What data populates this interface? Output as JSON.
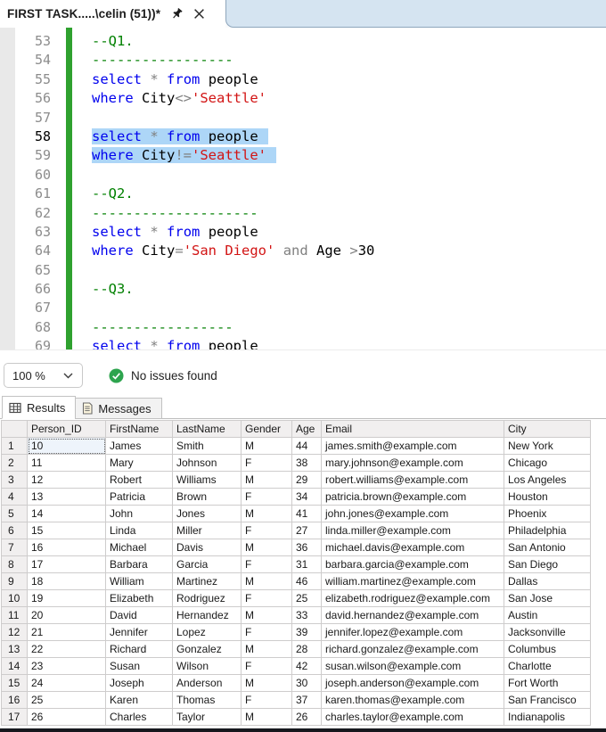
{
  "tab": {
    "title": "FIRST TASK.....\\celin (51))*"
  },
  "colors": {
    "keyword": "#0000ee",
    "operator": "#808080",
    "string": "#d21414",
    "comment": "#008000",
    "selection": "#add6f7",
    "change_bar": "#2fa12f",
    "status_check": "#2da44e",
    "tab_well_fill": "#d5e4f1"
  },
  "editor": {
    "lines": [
      {
        "no": "53",
        "tokens": [
          {
            "c": "c",
            "t": "--Q1."
          }
        ]
      },
      {
        "no": "54",
        "tokens": [
          {
            "c": "c",
            "t": "-----------------"
          }
        ]
      },
      {
        "no": "55",
        "tokens": [
          {
            "c": "k",
            "t": "select"
          },
          {
            "c": "p",
            "t": " "
          },
          {
            "c": "o",
            "t": "*"
          },
          {
            "c": "p",
            "t": " "
          },
          {
            "c": "k",
            "t": "from"
          },
          {
            "c": "p",
            "t": " people"
          }
        ]
      },
      {
        "no": "56",
        "tokens": [
          {
            "c": "k",
            "t": "where"
          },
          {
            "c": "p",
            "t": " City"
          },
          {
            "c": "o",
            "t": "<>"
          },
          {
            "c": "s",
            "t": "'Seattle'"
          }
        ]
      },
      {
        "no": "57",
        "tokens": []
      },
      {
        "no": "58",
        "sel": true,
        "cur": true,
        "tokens": [
          {
            "c": "k",
            "t": "select"
          },
          {
            "c": "p",
            "t": " "
          },
          {
            "c": "o",
            "t": "*"
          },
          {
            "c": "p",
            "t": " "
          },
          {
            "c": "k",
            "t": "from"
          },
          {
            "c": "p",
            "t": " people"
          }
        ]
      },
      {
        "no": "59",
        "sel": true,
        "tokens": [
          {
            "c": "k",
            "t": "where"
          },
          {
            "c": "p",
            "t": " City"
          },
          {
            "c": "o",
            "t": "!="
          },
          {
            "c": "s",
            "t": "'Seattle'"
          }
        ]
      },
      {
        "no": "60",
        "tokens": []
      },
      {
        "no": "61",
        "tokens": [
          {
            "c": "c",
            "t": "--Q2."
          }
        ]
      },
      {
        "no": "62",
        "tokens": [
          {
            "c": "c",
            "t": "--------------------"
          }
        ]
      },
      {
        "no": "63",
        "tokens": [
          {
            "c": "k",
            "t": "select"
          },
          {
            "c": "p",
            "t": " "
          },
          {
            "c": "o",
            "t": "*"
          },
          {
            "c": "p",
            "t": " "
          },
          {
            "c": "k",
            "t": "from"
          },
          {
            "c": "p",
            "t": " people"
          }
        ]
      },
      {
        "no": "64",
        "tokens": [
          {
            "c": "k",
            "t": "where"
          },
          {
            "c": "p",
            "t": " City"
          },
          {
            "c": "o",
            "t": "="
          },
          {
            "c": "s",
            "t": "'San Diego'"
          },
          {
            "c": "p",
            "t": " "
          },
          {
            "c": "o",
            "t": "and"
          },
          {
            "c": "p",
            "t": " Age "
          },
          {
            "c": "o",
            "t": ">"
          },
          {
            "c": "p",
            "t": "30"
          }
        ]
      },
      {
        "no": "65",
        "tokens": []
      },
      {
        "no": "66",
        "tokens": [
          {
            "c": "c",
            "t": "--Q3."
          }
        ]
      },
      {
        "no": "67",
        "tokens": []
      },
      {
        "no": "68",
        "tokens": [
          {
            "c": "c",
            "t": "-----------------"
          }
        ]
      },
      {
        "no": "69",
        "tokens": [
          {
            "c": "k",
            "t": "select"
          },
          {
            "c": "p",
            "t": " "
          },
          {
            "c": "o",
            "t": "*"
          },
          {
            "c": "p",
            "t": " "
          },
          {
            "c": "k",
            "t": "from"
          },
          {
            "c": "p",
            "t": " people"
          }
        ]
      }
    ]
  },
  "statusbar": {
    "zoom": "100 %",
    "message": "No issues found"
  },
  "result_tabs": {
    "results": "Results",
    "messages": "Messages"
  },
  "grid": {
    "columns": [
      "Person_ID",
      "FirstName",
      "LastName",
      "Gender",
      "Age",
      "Email",
      "City"
    ],
    "rows": [
      [
        "10",
        "James",
        "Smith",
        "M",
        "44",
        "james.smith@example.com",
        "New York"
      ],
      [
        "11",
        "Mary",
        "Johnson",
        "F",
        "38",
        "mary.johnson@example.com",
        "Chicago"
      ],
      [
        "12",
        "Robert",
        "Williams",
        "M",
        "29",
        "robert.williams@example.com",
        "Los Angeles"
      ],
      [
        "13",
        "Patricia",
        "Brown",
        "F",
        "34",
        "patricia.brown@example.com",
        "Houston"
      ],
      [
        "14",
        "John",
        "Jones",
        "M",
        "41",
        "john.jones@example.com",
        "Phoenix"
      ],
      [
        "15",
        "Linda",
        "Miller",
        "F",
        "27",
        "linda.miller@example.com",
        "Philadelphia"
      ],
      [
        "16",
        "Michael",
        "Davis",
        "M",
        "36",
        "michael.davis@example.com",
        "San Antonio"
      ],
      [
        "17",
        "Barbara",
        "Garcia",
        "F",
        "31",
        "barbara.garcia@example.com",
        "San Diego"
      ],
      [
        "18",
        "William",
        "Martinez",
        "M",
        "46",
        "william.martinez@example.com",
        "Dallas"
      ],
      [
        "19",
        "Elizabeth",
        "Rodriguez",
        "F",
        "25",
        "elizabeth.rodriguez@example.com",
        "San Jose"
      ],
      [
        "20",
        "David",
        "Hernandez",
        "M",
        "33",
        "david.hernandez@example.com",
        "Austin"
      ],
      [
        "21",
        "Jennifer",
        "Lopez",
        "F",
        "39",
        "jennifer.lopez@example.com",
        "Jacksonville"
      ],
      [
        "22",
        "Richard",
        "Gonzalez",
        "M",
        "28",
        "richard.gonzalez@example.com",
        "Columbus"
      ],
      [
        "23",
        "Susan",
        "Wilson",
        "F",
        "42",
        "susan.wilson@example.com",
        "Charlotte"
      ],
      [
        "24",
        "Joseph",
        "Anderson",
        "M",
        "30",
        "joseph.anderson@example.com",
        "Fort Worth"
      ],
      [
        "25",
        "Karen",
        "Thomas",
        "F",
        "37",
        "karen.thomas@example.com",
        "San Francisco"
      ],
      [
        "26",
        "Charles",
        "Taylor",
        "M",
        "26",
        "charles.taylor@example.com",
        "Indianapolis"
      ]
    ]
  }
}
